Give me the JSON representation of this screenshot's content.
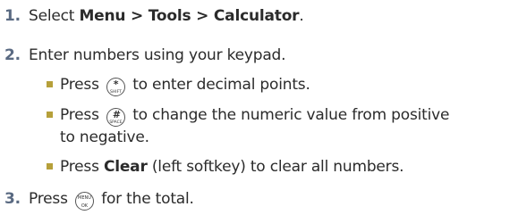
{
  "steps": [
    {
      "number": "1.",
      "prefix": "Select ",
      "bold": "Menu > Tools > Calculator",
      "suffix": "."
    },
    {
      "number": "2.",
      "text": "Enter numbers using your keypad."
    },
    {
      "number": "3.",
      "before": "Press",
      "after": "for the total."
    }
  ],
  "sub_items": [
    {
      "before": "Press",
      "key_main": "*",
      "key_small": "SHIFT",
      "after": "to enter decimal points."
    },
    {
      "before": "Press",
      "key_main": "#",
      "key_small": "SPACE",
      "after_line1": "to change the numeric value from positive",
      "after_line2": "to negative."
    },
    {
      "before": "Press ",
      "bold": "Clear",
      "after": " (left softkey) to clear all numbers."
    }
  ],
  "menu_key": {
    "top": "MENU",
    "bottom": "OK"
  },
  "colors": {
    "step_number": "#5a6a82",
    "bullet": "#b6a03a",
    "text": "#2b2b2b"
  }
}
